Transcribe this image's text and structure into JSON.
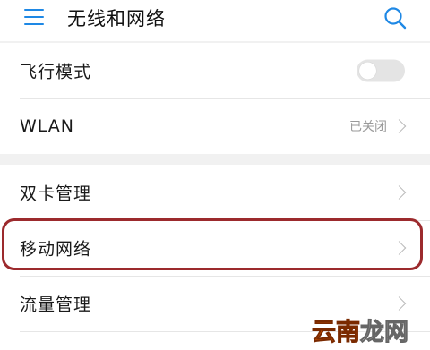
{
  "header": {
    "title": "无线和网络",
    "menu_icon": "menu-icon",
    "search_icon": "search-icon",
    "accent_color": "#1e88e5"
  },
  "settings": {
    "airplane_mode": {
      "label": "飞行模式",
      "toggle_on": false
    },
    "wlan": {
      "label": "WLAN",
      "value": "已关闭"
    },
    "dual_sim": {
      "label": "双卡管理"
    },
    "mobile_network": {
      "label": "移动网络",
      "highlighted": true,
      "highlight_color": "#9c2a2d"
    },
    "data_usage": {
      "label": "流量管理"
    }
  },
  "watermark": {
    "part1": "云南",
    "part2": "龙网"
  }
}
